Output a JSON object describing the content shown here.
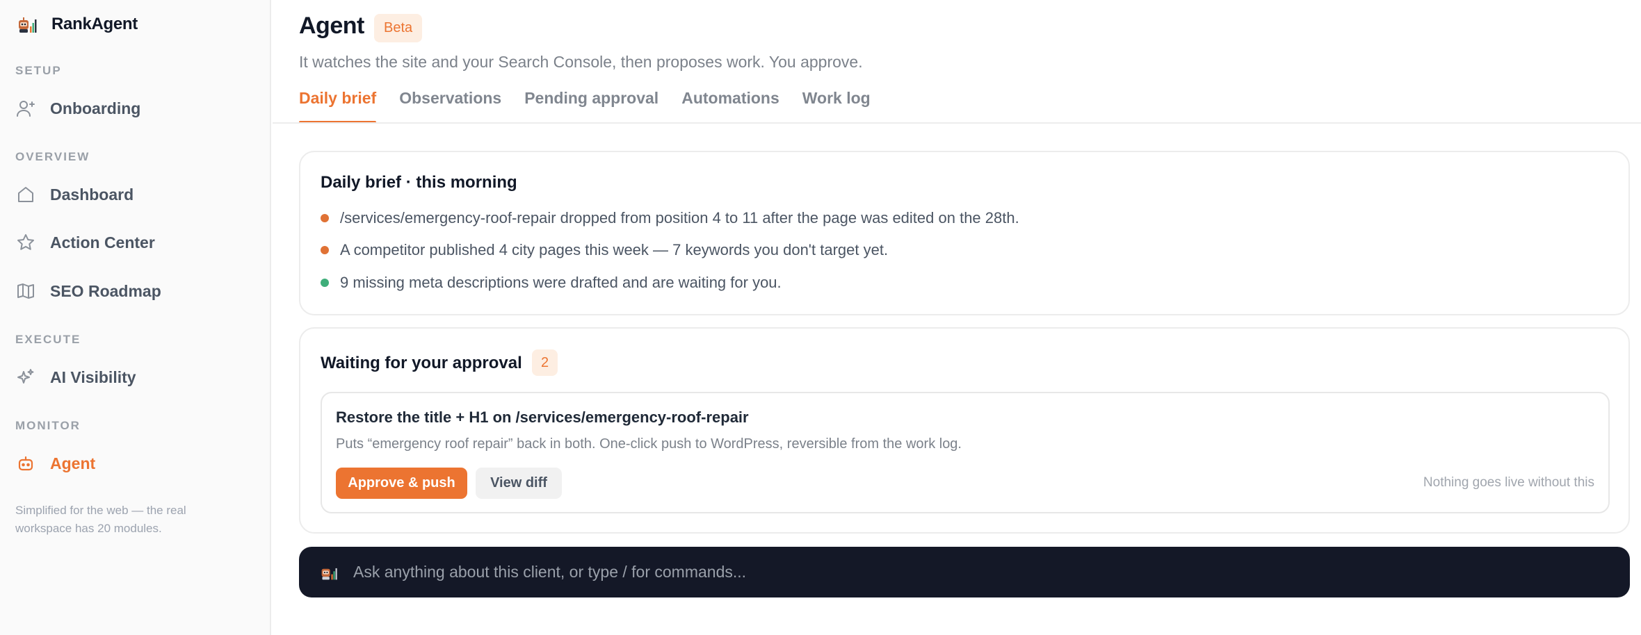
{
  "brand": {
    "name": "RankAgent",
    "logo_icon": "robot-chart-icon"
  },
  "sidebar": {
    "sections": [
      {
        "label": "SETUP"
      },
      {
        "label": "OVERVIEW"
      },
      {
        "label": "EXECUTE"
      },
      {
        "label": "MONITOR"
      }
    ],
    "items": [
      {
        "label": "Onboarding",
        "icon": "user-plus-icon"
      },
      {
        "label": "Dashboard",
        "icon": "home-icon"
      },
      {
        "label": "Action Center",
        "icon": "star-icon"
      },
      {
        "label": "SEO Roadmap",
        "icon": "map-icon"
      },
      {
        "label": "AI Visibility",
        "icon": "sparkles-icon"
      },
      {
        "label": "Agent",
        "icon": "robot-icon",
        "active": true
      }
    ],
    "note": "Simplified for the web — the real workspace has 20 modules."
  },
  "header": {
    "title": "Agent",
    "badge": "Beta",
    "subtitle": "It watches the site and your Search Console, then proposes work. You approve."
  },
  "tabs": [
    {
      "label": "Daily brief",
      "active": true
    },
    {
      "label": "Observations"
    },
    {
      "label": "Pending approval"
    },
    {
      "label": "Automations"
    },
    {
      "label": "Work log"
    }
  ],
  "brief": {
    "title": "Daily brief · this morning",
    "items": [
      {
        "text": "/services/emergency-roof-repair dropped from position 4 to 11 after the page was edited on the 28th.",
        "color": "#e07235"
      },
      {
        "text": "A competitor published 4 city pages this week — 7 keywords you don't target yet.",
        "color": "#e07235"
      },
      {
        "text": "9 missing meta descriptions were drafted and are waiting for you.",
        "color": "#3fae7a"
      }
    ]
  },
  "approval": {
    "title": "Waiting for your approval",
    "count": "2",
    "proposal": {
      "title": "Restore the title + H1 on /services/emergency-roof-repair",
      "description": "Puts “emergency roof repair” back in both. One-click push to WordPress, reversible from the work log.",
      "primary_label": "Approve & push",
      "secondary_label": "View diff",
      "note": "Nothing goes live without this"
    }
  },
  "ask": {
    "placeholder": "Ask anything about this client, or type / for commands..."
  },
  "colors": {
    "accent": "#ec7431",
    "dark": "#141827",
    "success": "#3fae7a"
  }
}
